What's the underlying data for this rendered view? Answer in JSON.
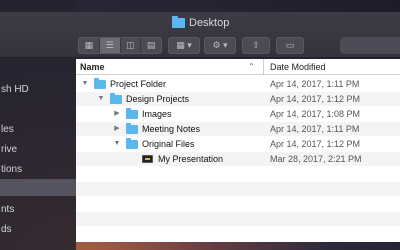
{
  "window": {
    "title": "Desktop",
    "title_icon": "folder-icon"
  },
  "sidebar": {
    "items": [
      {
        "label": "sh HD",
        "selected": false
      },
      {
        "label": "les",
        "selected": false
      },
      {
        "label": "rive",
        "selected": false
      },
      {
        "label": "tions",
        "selected": false
      },
      {
        "label": "",
        "selected": true
      },
      {
        "label": "nts",
        "selected": false
      },
      {
        "label": "ds",
        "selected": false
      }
    ]
  },
  "toolbar": {
    "view_buttons": [
      "icon-view",
      "list-view",
      "column-view",
      "gallery-view"
    ],
    "active_view": "list-view",
    "arrange_icon": "grid-icon",
    "action_icon": "gear-icon",
    "share_icon": "share-icon",
    "tag_icon": "tag-icon"
  },
  "list": {
    "columns": {
      "name": "Name",
      "date": "Date Modified"
    },
    "rows": [
      {
        "name": "Project Folder",
        "date": "Apr 14, 2017, 1:11 PM",
        "indent": 0,
        "kind": "folder",
        "expanded": true
      },
      {
        "name": "Design Projects",
        "date": "Apr 14, 2017, 1:12 PM",
        "indent": 1,
        "kind": "folder",
        "expanded": true
      },
      {
        "name": "Images",
        "date": "Apr 14, 2017, 1:08 PM",
        "indent": 2,
        "kind": "folder",
        "expanded": false
      },
      {
        "name": "Meeting Notes",
        "date": "Apr 14, 2017, 1:11 PM",
        "indent": 2,
        "kind": "folder",
        "expanded": false
      },
      {
        "name": "Original Files",
        "date": "Apr 14, 2017, 1:12 PM",
        "indent": 2,
        "kind": "folder",
        "expanded": true
      },
      {
        "name": "My Presentation",
        "date": "Mar 28, 2017, 2:21 PM",
        "indent": 3,
        "kind": "keynote",
        "expanded": false
      }
    ]
  }
}
